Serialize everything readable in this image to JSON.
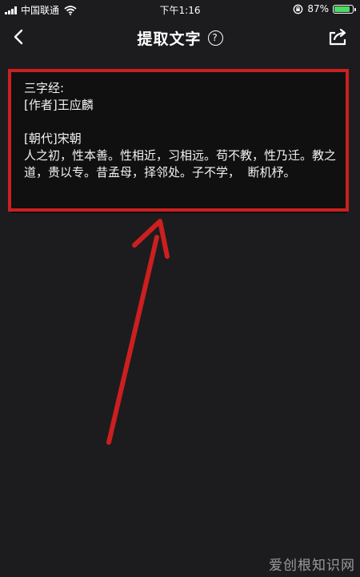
{
  "status_bar": {
    "carrier": "中国联通",
    "time": "下午1:16",
    "battery_percent": "87%",
    "battery_level": 0.87
  },
  "nav": {
    "title": "提取文字",
    "help_glyph": "?"
  },
  "ocr": {
    "text": "三字经:\n[作者]王应麟\n\n[朝代]宋朝\n人之初，性本善。性相近，习相远。苟不教，性乃迁。教之道，贵以专。昔孟母，择邻处。子不学，  断机杼。"
  },
  "watermark": "爱创根知识网",
  "colors": {
    "background": "#1c1c1e",
    "highlight": "#cc1f1f",
    "text": "#f2f2f2"
  }
}
